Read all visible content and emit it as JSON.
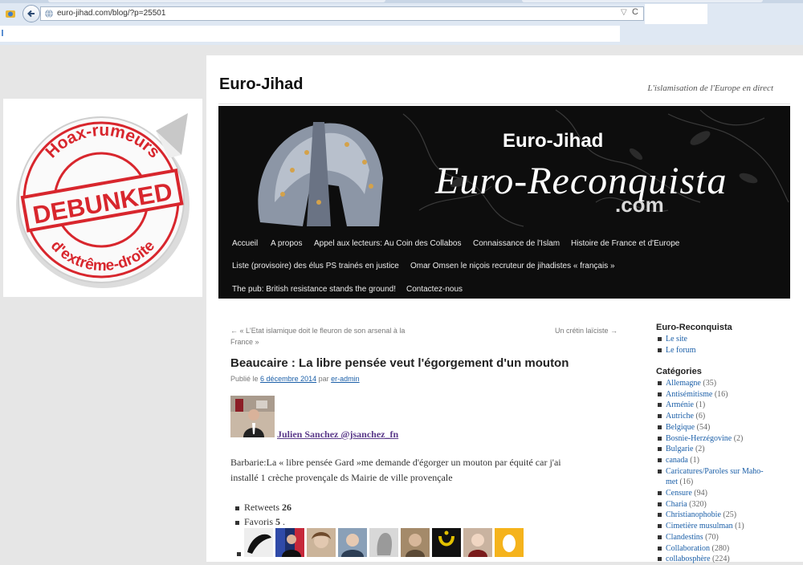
{
  "browser": {
    "url": "euro-jihad.com/blog/?p=25501",
    "dropdown_glyph": "▽",
    "reload_glyph": "C"
  },
  "debunk_stamp": {
    "top_arc": "Hoax-rumeurs",
    "center": "DEBUNKED",
    "bottom_arc": "d'extrême-droite",
    "color": "#d8262d"
  },
  "site": {
    "title": "Euro-Jihad",
    "tagline": "L'islamisation de l'Europe en direct"
  },
  "banner": {
    "title": "Euro-Jihad",
    "script": "Euro-Reconquista",
    "com": ".com"
  },
  "nav": {
    "items": [
      "Accueil",
      "A propos",
      "Appel aux lecteurs: Au Coin des Collabos",
      "Connaissance de l'Islam",
      "Histoire de France et d'Europe",
      "Liste (provisoire) des élus PS trainés en justice",
      "Omar Omsen le niçois recruteur de jihadistes « français »",
      "The pub: British resistance stands the ground!",
      "Contactez-nous"
    ]
  },
  "post": {
    "prev_line1": "← « L'Etat islamique doit le fleuron de son arsenal à la",
    "prev_line2": "France »",
    "next": "Un crétin laïciste →",
    "title": "Beaucaire : La libre pensée veut l'égorgement d'un mouton",
    "meta_prefix": "Publié le",
    "date": "6 décembre 2014",
    "meta_by": "par",
    "author": "er-admin",
    "tweet_author": "Julien Sanchez @jsanchez_fn",
    "tweet_text": "Barbarie:La « libre pensée Gard »me demande d'égorger un mouton par équité car j'ai installé 1 crèche provençale ds Mairie de ville provençale",
    "retweets_label": "Retweets",
    "retweets": "26",
    "favoris_label": "Favoris",
    "favoris": "5",
    "favoris_suffix": "."
  },
  "sidebar": {
    "reconquista_heading": "Euro-Reconquista",
    "reconquista_links": [
      "Le site",
      "Le forum"
    ],
    "categories_heading": "Catégories",
    "categories": [
      {
        "name": "Allemagne",
        "count": "(35)"
      },
      {
        "name": "Antisémitisme",
        "count": "(16)"
      },
      {
        "name": "Arménie",
        "count": "(1)"
      },
      {
        "name": "Autriche",
        "count": "(6)"
      },
      {
        "name": "Belgique",
        "count": "(54)"
      },
      {
        "name": "Bosnie-Herzégovine",
        "count": "(2)"
      },
      {
        "name": "Bulgarie",
        "count": "(2)"
      },
      {
        "name": "canada",
        "count": "(1)"
      },
      {
        "name": "Caricatures/Paroles sur Maho-",
        "count": ""
      },
      {
        "name": "met",
        "count": "(16)"
      },
      {
        "name": "Censure",
        "count": "(94)"
      },
      {
        "name": "Charia",
        "count": "(320)"
      },
      {
        "name": "Christianophobie",
        "count": "(25)"
      },
      {
        "name": "Cimetière musulman",
        "count": "(1)"
      },
      {
        "name": "Clandestins",
        "count": "(70)"
      },
      {
        "name": "Collaboration",
        "count": "(280)"
      },
      {
        "name": "collabosphère",
        "count": "(224)"
      }
    ]
  }
}
